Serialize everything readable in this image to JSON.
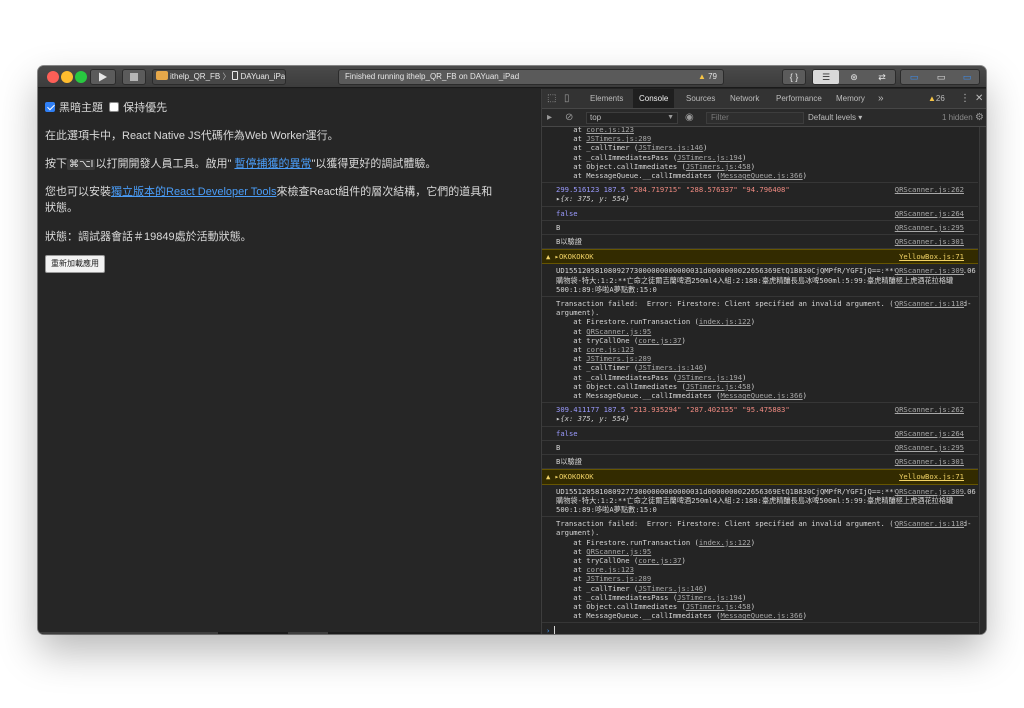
{
  "toolbar": {
    "scheme_app": "ithelp_QR_FB",
    "scheme_device": "DAYuan_iPad",
    "status": "Finished running ithelp_QR_FB on DAYuan_iPad",
    "warning_count": "79",
    "warning_icon": "warning-triangle-icon"
  },
  "app": {
    "dark_theme_label": "黑暗主題",
    "dark_theme_checked": true,
    "priority_label": "保持優先",
    "priority_checked": false,
    "line1": "在此選項卡中，React Native JS代碼作為Web Worker運行。",
    "line2_prefix": "按下",
    "line2_keys": "⌘⌥I",
    "line2_middle": "以打開開發人員工具。啟用\" ",
    "line2_link": "暫停捕獲的異常",
    "line2_suffix": "\"以獲得更好的調試體驗。",
    "line3_prefix": "您也可以安裝",
    "line3_link": "獨立版本的React Developer Tools",
    "line3_suffix": "來檢查React組件的層次結構，它們的道具和",
    "line3_wrap": "狀態。",
    "line4": "狀態：調試器會話＃19849處於活動狀態。",
    "reload_button": "重新加載應用"
  },
  "devtools": {
    "tabs": [
      "Elements",
      "Console",
      "Sources",
      "Network",
      "Performance",
      "Memory"
    ],
    "active_tab": "Console",
    "more": "»",
    "warning_badge": "26",
    "context": "top",
    "filter_placeholder": "Filter",
    "levels": "Default levels ▾",
    "hidden": "1 hidden",
    "console": {
      "stack_head": [
        "    at core.js:123",
        "    at JSTimers.js:289",
        "    at _callTimer (JSTimers.js:146)",
        "    at _callImmediatesPass (JSTimers.js:194)",
        "    at Object.callImmediates (JSTimers.js:458)",
        "    at MessageQueue.__callImmediates (MessageQueue.js:366)"
      ],
      "group1": {
        "log_num": "299.516123 187.5",
        "log_strs": "\"204.719715\" \"288.576337\" \"94.796408\"",
        "log_src": "QRScanner.js:262",
        "obj": "{x: 375, y: 554}",
        "false_text": "false",
        "false_src": "QRScanner.js:264",
        "b_text": "B",
        "b_src": "QRScanner.js:295",
        "verify_text": "B以驗證",
        "verify_src": "QRScanner.js:301",
        "warn_text": "▸OKOKOKOK",
        "warn_src": "YellowBox.js:71",
        "data_text": "UD15512058108092773000000000000031d0000000022656369EtQ1B830CjQMPfR/YGFIjQ==:**********:5:5:1:0.06購物袋-特大:1:2:**亡命之徒爾吉蘭啤酒250ml4入組:2:188:臺虎精釀長島冰啤500ml:5:99:臺虎精釀極上虎酒花拉格罐500:1:89:哆啦A夢點數:15:0",
        "data_src": "QRScanner.js:309",
        "err_text": "Transaction failed:  Error: Firestore: Client specified an invalid argument. (firestore/invalid-argument).",
        "err_src": "QRScanner.js:118",
        "trace": [
          "    at Firestore.runTransaction (index.js:122)",
          "    at QRScanner.js:95",
          "    at tryCallOne (core.js:37)",
          "    at core.js:123",
          "    at JSTimers.js:289",
          "    at _callTimer (JSTimers.js:146)",
          "    at _callImmediatesPass (JSTimers.js:194)",
          "    at Object.callImmediates (JSTimers.js:458)",
          "    at MessageQueue.__callImmediates (MessageQueue.js:366)"
        ]
      },
      "group2": {
        "log_num": "309.411177 187.5",
        "log_strs": "\"213.935294\" \"287.402155\" \"95.475883\"",
        "log_src": "QRScanner.js:262",
        "obj": "{x: 375, y: 554}",
        "false_text": "false",
        "false_src": "QRScanner.js:264",
        "b_text": "B",
        "b_src": "QRScanner.js:295",
        "verify_text": "B以驗證",
        "verify_src": "QRScanner.js:301",
        "warn_text": "▸OKOKOKOK",
        "warn_src": "YellowBox.js:71",
        "data_text": "UD15512058108092773000000000000031d0000000022656369EtQ1B830CjQMPfR/YGFIjQ==:**********:5:5:1:0.06購物袋-特大:1:2:**亡命之徒爾吉蘭啤酒250ml4入組:2:188:臺虎精釀長島冰啤500ml:5:99:臺虎精釀極上虎酒花拉格罐500:1:89:哆啦A夢點數:15:0",
        "data_src": "QRScanner.js:309",
        "err_text": "Transaction failed:  Error: Firestore: Client specified an invalid argument. (firestore/invalid-argument).",
        "err_src": "QRScanner.js:118",
        "trace": [
          "    at Firestore.runTransaction (index.js:122)",
          "    at QRScanner.js:95",
          "    at tryCallOne (core.js:37)",
          "    at core.js:123",
          "    at JSTimers.js:289",
          "    at _callTimer (JSTimers.js:146)",
          "    at _callImmediatesPass (JSTimers.js:194)",
          "    at Object.callImmediates (JSTimers.js:458)",
          "    at MessageQueue.__callImmediates (MessageQueue.js:366)"
        ]
      },
      "prompt": "›"
    }
  }
}
